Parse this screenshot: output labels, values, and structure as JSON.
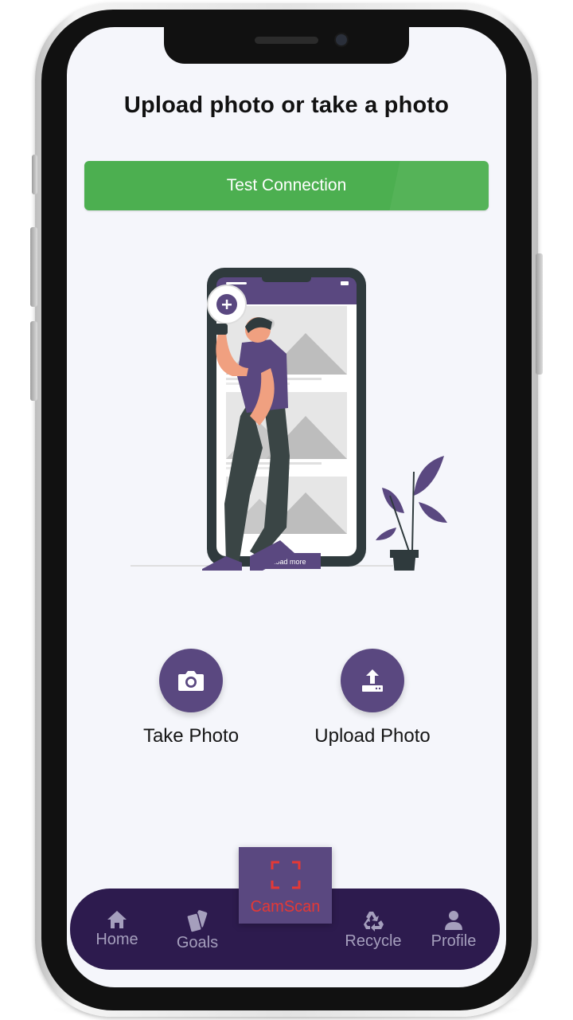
{
  "screen": {
    "title": "Upload photo or take a photo",
    "test_connection_label": "Test Connection"
  },
  "illustration": {
    "load_more_label": "Load more"
  },
  "actions": [
    {
      "label": "Take Photo",
      "icon": "camera-icon"
    },
    {
      "label": "Upload Photo",
      "icon": "upload-icon"
    }
  ],
  "tabbar": {
    "items": [
      {
        "label": "Home",
        "icon": "home-icon"
      },
      {
        "label": "Goals",
        "icon": "cards-icon"
      },
      {
        "label": "CamScan",
        "icon": "scan-frame-icon"
      },
      {
        "label": "Recycle",
        "icon": "recycle-icon"
      },
      {
        "label": "Profile",
        "icon": "person-icon"
      }
    ]
  },
  "colors": {
    "accent_purple": "#5a4880",
    "tabbar_bg": "#2d1b4e",
    "success_green": "#4caf50",
    "camscan_red": "#e53935",
    "tab_label": "#a59fbd",
    "screen_bg": "#f5f6fb"
  }
}
